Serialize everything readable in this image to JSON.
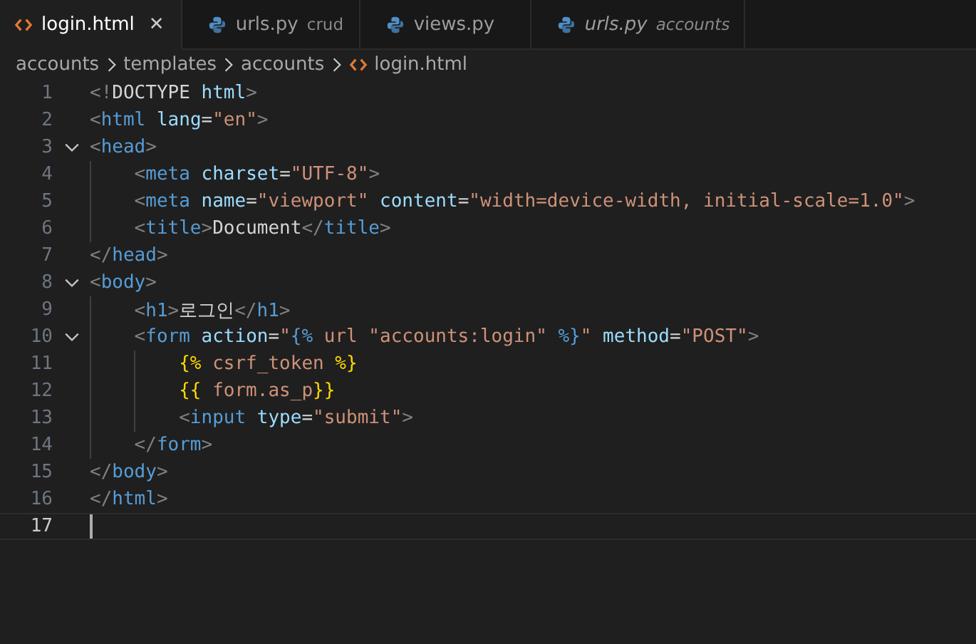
{
  "tabs": [
    {
      "kind": "html",
      "label": "login.html",
      "selected": true,
      "preview": false,
      "close": "✕"
    },
    {
      "kind": "python",
      "label": "urls.py",
      "description": "crud",
      "selected": false,
      "preview": false
    },
    {
      "kind": "python",
      "label": "views.py",
      "selected": false,
      "preview": false
    },
    {
      "kind": "python",
      "label": "urls.py",
      "description": "accounts",
      "selected": false,
      "preview": true
    }
  ],
  "breadcrumb": [
    {
      "label": "accounts"
    },
    {
      "label": "templates"
    },
    {
      "label": "accounts"
    },
    {
      "label": "login.html",
      "kind": "html"
    }
  ],
  "editor": {
    "lines": [
      {
        "number": "1",
        "current": false,
        "tokens": [
          {
            "kind": "punct",
            "text": "<!"
          },
          {
            "kind": "doctype",
            "text": "DOCTYPE"
          },
          {
            "kind": "attr",
            "text": " html"
          },
          {
            "kind": "punct",
            "text": ">"
          }
        ]
      },
      {
        "number": "2",
        "current": false,
        "tokens": [
          {
            "kind": "punct",
            "text": "<"
          },
          {
            "kind": "tag",
            "text": "html"
          },
          {
            "kind": "attr",
            "text": " lang"
          },
          {
            "kind": "text",
            "text": "="
          },
          {
            "kind": "string",
            "text": "\"en\""
          },
          {
            "kind": "punct",
            "text": ">"
          }
        ]
      },
      {
        "number": "3",
        "current": false,
        "expanded": true,
        "tokens": [
          {
            "kind": "punct",
            "text": "<"
          },
          {
            "kind": "tag",
            "text": "head"
          },
          {
            "kind": "punct",
            "text": ">"
          }
        ],
        "children": [
          {
            "number": "4",
            "current": false,
            "tokens": [
              {
                "kind": "punct",
                "text": "<"
              },
              {
                "kind": "tag",
                "text": "meta"
              },
              {
                "kind": "attr",
                "text": " charset"
              },
              {
                "kind": "text",
                "text": "="
              },
              {
                "kind": "string",
                "text": "\"UTF-8\""
              },
              {
                "kind": "punct",
                "text": ">"
              }
            ]
          },
          {
            "number": "5",
            "current": false,
            "tokens": [
              {
                "kind": "punct",
                "text": "<"
              },
              {
                "kind": "tag",
                "text": "meta"
              },
              {
                "kind": "attr",
                "text": " name"
              },
              {
                "kind": "text",
                "text": "="
              },
              {
                "kind": "string",
                "text": "\"viewport\""
              },
              {
                "kind": "attr",
                "text": " content"
              },
              {
                "kind": "text",
                "text": "="
              },
              {
                "kind": "string",
                "text": "\"width=device-width, initial-scale=1.0\""
              },
              {
                "kind": "punct",
                "text": ">"
              }
            ]
          },
          {
            "number": "6",
            "current": false,
            "tokens": [
              {
                "kind": "punct",
                "text": "<"
              },
              {
                "kind": "tag",
                "text": "title"
              },
              {
                "kind": "punct",
                "text": ">"
              },
              {
                "kind": "text",
                "text": "Document"
              },
              {
                "kind": "punct",
                "text": "</"
              },
              {
                "kind": "tag",
                "text": "title"
              },
              {
                "kind": "punct",
                "text": ">"
              }
            ]
          }
        ]
      },
      {
        "number": "7",
        "current": false,
        "tokens": [
          {
            "kind": "punct",
            "text": "</"
          },
          {
            "kind": "tag",
            "text": "head"
          },
          {
            "kind": "punct",
            "text": ">"
          }
        ]
      },
      {
        "number": "8",
        "current": false,
        "expanded": true,
        "tokens": [
          {
            "kind": "punct",
            "text": "<"
          },
          {
            "kind": "tag",
            "text": "body"
          },
          {
            "kind": "punct",
            "text": ">"
          }
        ],
        "children": [
          {
            "number": "9",
            "current": false,
            "tokens": [
              {
                "kind": "punct",
                "text": "<"
              },
              {
                "kind": "tag",
                "text": "h1"
              },
              {
                "kind": "punct",
                "text": ">"
              },
              {
                "kind": "text",
                "text": "로그인"
              },
              {
                "kind": "punct",
                "text": "</"
              },
              {
                "kind": "tag",
                "text": "h1"
              },
              {
                "kind": "punct",
                "text": ">"
              }
            ]
          },
          {
            "number": "10",
            "current": false,
            "expanded": true,
            "tokens": [
              {
                "kind": "punct",
                "text": "<"
              },
              {
                "kind": "tag",
                "text": "form"
              },
              {
                "kind": "attr",
                "text": " action"
              },
              {
                "kind": "text",
                "text": "="
              },
              {
                "kind": "string",
                "text": "\""
              },
              {
                "kind": "tagbrace",
                "text": "{%"
              },
              {
                "kind": "string",
                "text": " url \"accounts:login\" "
              },
              {
                "kind": "tagbrace",
                "text": "%}"
              },
              {
                "kind": "string",
                "text": "\""
              },
              {
                "kind": "attr",
                "text": " method"
              },
              {
                "kind": "text",
                "text": "="
              },
              {
                "kind": "string",
                "text": "\"POST\""
              },
              {
                "kind": "punct",
                "text": ">"
              }
            ],
            "children": [
              {
                "number": "11",
                "current": false,
                "tokens": [
                  {
                    "kind": "brace",
                    "text": "{%"
                  },
                  {
                    "kind": "string",
                    "text": " csrf_token "
                  },
                  {
                    "kind": "brace",
                    "text": "%}"
                  }
                ]
              },
              {
                "number": "12",
                "current": false,
                "tokens": [
                  {
                    "kind": "brace",
                    "text": "{{"
                  },
                  {
                    "kind": "string",
                    "text": " form.as_p"
                  },
                  {
                    "kind": "brace",
                    "text": "}}"
                  }
                ]
              },
              {
                "number": "13",
                "current": false,
                "tokens": [
                  {
                    "kind": "punct",
                    "text": "<"
                  },
                  {
                    "kind": "tag",
                    "text": "input"
                  },
                  {
                    "kind": "attr",
                    "text": " type"
                  },
                  {
                    "kind": "text",
                    "text": "="
                  },
                  {
                    "kind": "string",
                    "text": "\"submit\""
                  },
                  {
                    "kind": "punct",
                    "text": ">"
                  }
                ]
              }
            ]
          },
          {
            "number": "14",
            "current": false,
            "tokens": [
              {
                "kind": "punct",
                "text": "</"
              },
              {
                "kind": "tag",
                "text": "form"
              },
              {
                "kind": "punct",
                "text": ">"
              }
            ]
          }
        ]
      },
      {
        "number": "15",
        "current": false,
        "tokens": [
          {
            "kind": "punct",
            "text": "</"
          },
          {
            "kind": "tag",
            "text": "body"
          },
          {
            "kind": "punct",
            "text": ">"
          }
        ]
      },
      {
        "number": "16",
        "current": false,
        "tokens": [
          {
            "kind": "punct",
            "text": "</"
          },
          {
            "kind": "tag",
            "text": "html"
          },
          {
            "kind": "punct",
            "text": ">"
          }
        ]
      },
      {
        "number": "17",
        "current": true
      }
    ]
  }
}
